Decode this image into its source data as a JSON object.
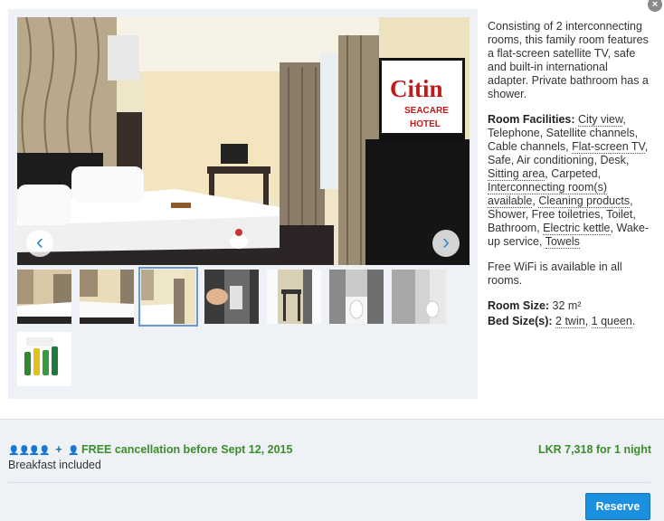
{
  "close_label": "×",
  "gallery": {
    "hotel_sign_line1": "Citin",
    "hotel_sign_line2": "SEACARE",
    "hotel_sign_line3": "HOTEL",
    "prev_glyph": "‹",
    "next_glyph": "›",
    "thumbnail_count": 8,
    "active_thumbnail_index": 2
  },
  "description": {
    "intro": "Consisting of 2 interconnecting rooms, this family room features a flat-screen satellite TV, safe and built-in international adapter. Private bathroom has a shower.",
    "facilities_label": "Room Facilities:",
    "facilities": [
      {
        "text": "City view",
        "link": true
      },
      {
        "text": "Telephone",
        "link": false
      },
      {
        "text": "Satellite channels",
        "link": false
      },
      {
        "text": "Cable channels",
        "link": false
      },
      {
        "text": "Flat-screen TV",
        "link": true
      },
      {
        "text": "Safe",
        "link": false
      },
      {
        "text": "Air conditioning",
        "link": false
      },
      {
        "text": "Desk",
        "link": false
      },
      {
        "text": "Sitting area",
        "link": true
      },
      {
        "text": "Carpeted",
        "link": false
      },
      {
        "text": "Interconnecting room(s) available",
        "link": true
      },
      {
        "text": "Cleaning products",
        "link": true
      },
      {
        "text": "Shower",
        "link": false
      },
      {
        "text": "Free toiletries",
        "link": false
      },
      {
        "text": "Toilet",
        "link": false
      },
      {
        "text": "Bathroom",
        "link": false
      },
      {
        "text": "Electric kettle",
        "link": true
      },
      {
        "text": "Wake-up service",
        "link": false
      },
      {
        "text": "Towels",
        "link": true
      }
    ],
    "wifi": "Free WiFi is available in all rooms.",
    "room_size_label": "Room Size:",
    "room_size_value": "32 m²",
    "bed_size_label": "Bed Size(s):",
    "bed_sizes": [
      "2 twin",
      "1 queen"
    ]
  },
  "offer": {
    "occupancy_icons": "👤👤👤👤",
    "plus": "+",
    "child_icon": "👤",
    "free_cancellation": "FREE cancellation before Sept 12, 2015",
    "breakfast": "Breakfast included",
    "price": "LKR 7,318 for 1 night",
    "reserve_label": "Reserve"
  },
  "colors": {
    "accent_blue": "#1b8fe0",
    "green": "#3b8c2a",
    "panel_bg": "#eef2f7"
  }
}
